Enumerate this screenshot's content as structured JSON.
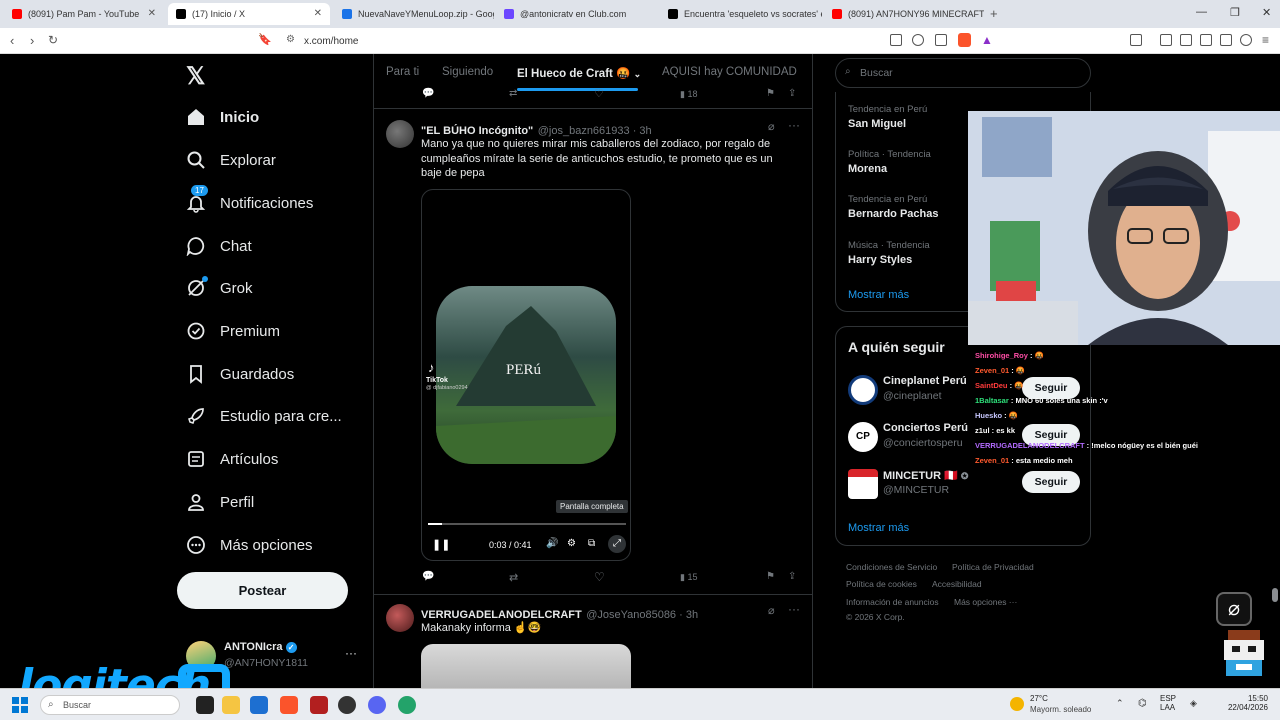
{
  "browser": {
    "tabs": [
      {
        "label": "(8091) Pam Pam - YouTube",
        "color": "#ff0000"
      },
      {
        "label": "(17) Inicio / X",
        "color": "#000000"
      },
      {
        "label": "NuevaNaveYMenuLoop.zip - Google",
        "color": "#1a73e8"
      },
      {
        "label": "@antonicratv en Club.com",
        "color": "#6b46ff"
      },
      {
        "label": "Encuentra 'esqueleto vs socrates' en",
        "color": "#000000"
      },
      {
        "label": "(8091) AN7HONY96 MINECRAFT STO",
        "color": "#ff0000"
      }
    ],
    "url": "x.com/home"
  },
  "nav": {
    "logo": "𝕏",
    "items": [
      {
        "label": "Inicio",
        "icon": "home-icon"
      },
      {
        "label": "Explorar",
        "icon": "search-icon"
      },
      {
        "label": "Notificaciones",
        "icon": "bell-icon",
        "badge": "17"
      },
      {
        "label": "Chat",
        "icon": "chat-icon"
      },
      {
        "label": "Grok",
        "icon": "grok-icon"
      },
      {
        "label": "Premium",
        "icon": "premium-icon"
      },
      {
        "label": "Guardados",
        "icon": "bookmark-icon"
      },
      {
        "label": "Estudio para cre...",
        "icon": "rocket-icon"
      },
      {
        "label": "Artículos",
        "icon": "article-icon"
      },
      {
        "label": "Perfil",
        "icon": "person-icon"
      },
      {
        "label": "Más opciones",
        "icon": "more-icon"
      }
    ],
    "post_label": "Postear",
    "account": {
      "name": "ANTONIcra",
      "handle": "@AN7HONY1811"
    }
  },
  "feed": {
    "tabs": [
      "Para ti",
      "Siguiendo",
      "El Hueco de Craft 🤬",
      "AQUISI hay COMUNIDAD"
    ],
    "prev_views": "18",
    "post1": {
      "name": "\"EL BÚHO Incógnito\"",
      "handle": "@jos_bazn661933 · 3h",
      "text": "Mano ya que no quieres mirar mis caballeros del zodiaco, por regalo de cumpleaños mírate la serie de anticuchos estudio, te prometo que es un baje de pepa",
      "video_caption": "PERú",
      "tiktok": "TikTok",
      "tiktok_user": "@ djfabiano0294",
      "tooltip": "Pantalla completa",
      "time": "0:03 / 0:41",
      "progress": 0.07,
      "views": "15"
    },
    "post2": {
      "name": "VERRUGADELANODELCRAFT",
      "handle": "@JoseYano85086 · 3h",
      "text": "Makanaky informa ☝🤓"
    }
  },
  "sidebar": {
    "search_placeholder": "Buscar",
    "trends": [
      {
        "cat": "Tendencia en Perú",
        "name": "San Miguel"
      },
      {
        "cat": "Política · Tendencia",
        "name": "Morena"
      },
      {
        "cat": "Tendencia en Perú",
        "name": "Bernardo Pachas"
      },
      {
        "cat": "Música · Tendencia",
        "name": "Harry Styles"
      }
    ],
    "show_more": "Mostrar más",
    "who_title": "A quién seguir",
    "follow": [
      {
        "name": "Cineplanet Perú",
        "handle": "@cineplanet"
      },
      {
        "name": "Conciertos Perú",
        "handle": "@conciertosperu"
      },
      {
        "name": "MINCETUR 🇵🇪",
        "handle": "@MINCETUR"
      }
    ],
    "follow_label": "Seguir",
    "footer": [
      "Condiciones de Servicio",
      "Política de Privacidad",
      "Política de cookies",
      "Accesibilidad",
      "Información de anuncios",
      "Más opciones ···",
      "© 2026 X Corp."
    ]
  },
  "chat": [
    {
      "user": "Shirohige_Roy",
      "msg": "🤬",
      "color": "#ff4da6"
    },
    {
      "user": "Zeven_01",
      "msg": "🤬",
      "color": "#ff5a2e"
    },
    {
      "user": "SaintDeu",
      "msg": "🤬",
      "color": "#ff3b3b"
    },
    {
      "user": "1Baltasar",
      "msg": "MNO 60 soles una skin :'v",
      "color": "#2ee07a"
    },
    {
      "user": "Huesko",
      "msg": "🤬",
      "color": "#c8c8ff"
    },
    {
      "user": "z1ul",
      "msg": "es kk",
      "color": "#ffffff"
    },
    {
      "user": "VERRUGADELANODELCRAFT",
      "msg": "!melco nógüey es el bién guéi",
      "color": "#b36bff"
    },
    {
      "user": "Zeven_01",
      "msg": "esta medio meh",
      "color": "#ff5a2e"
    }
  ],
  "overlay": {
    "logo": "logitech"
  },
  "taskbar": {
    "search": "Buscar",
    "weather_temp": "27°C",
    "weather_desc": "Mayorm. soleado",
    "lang1": "ESP",
    "lang2": "LAA",
    "time": "15:50",
    "date": "22/04/2026"
  }
}
